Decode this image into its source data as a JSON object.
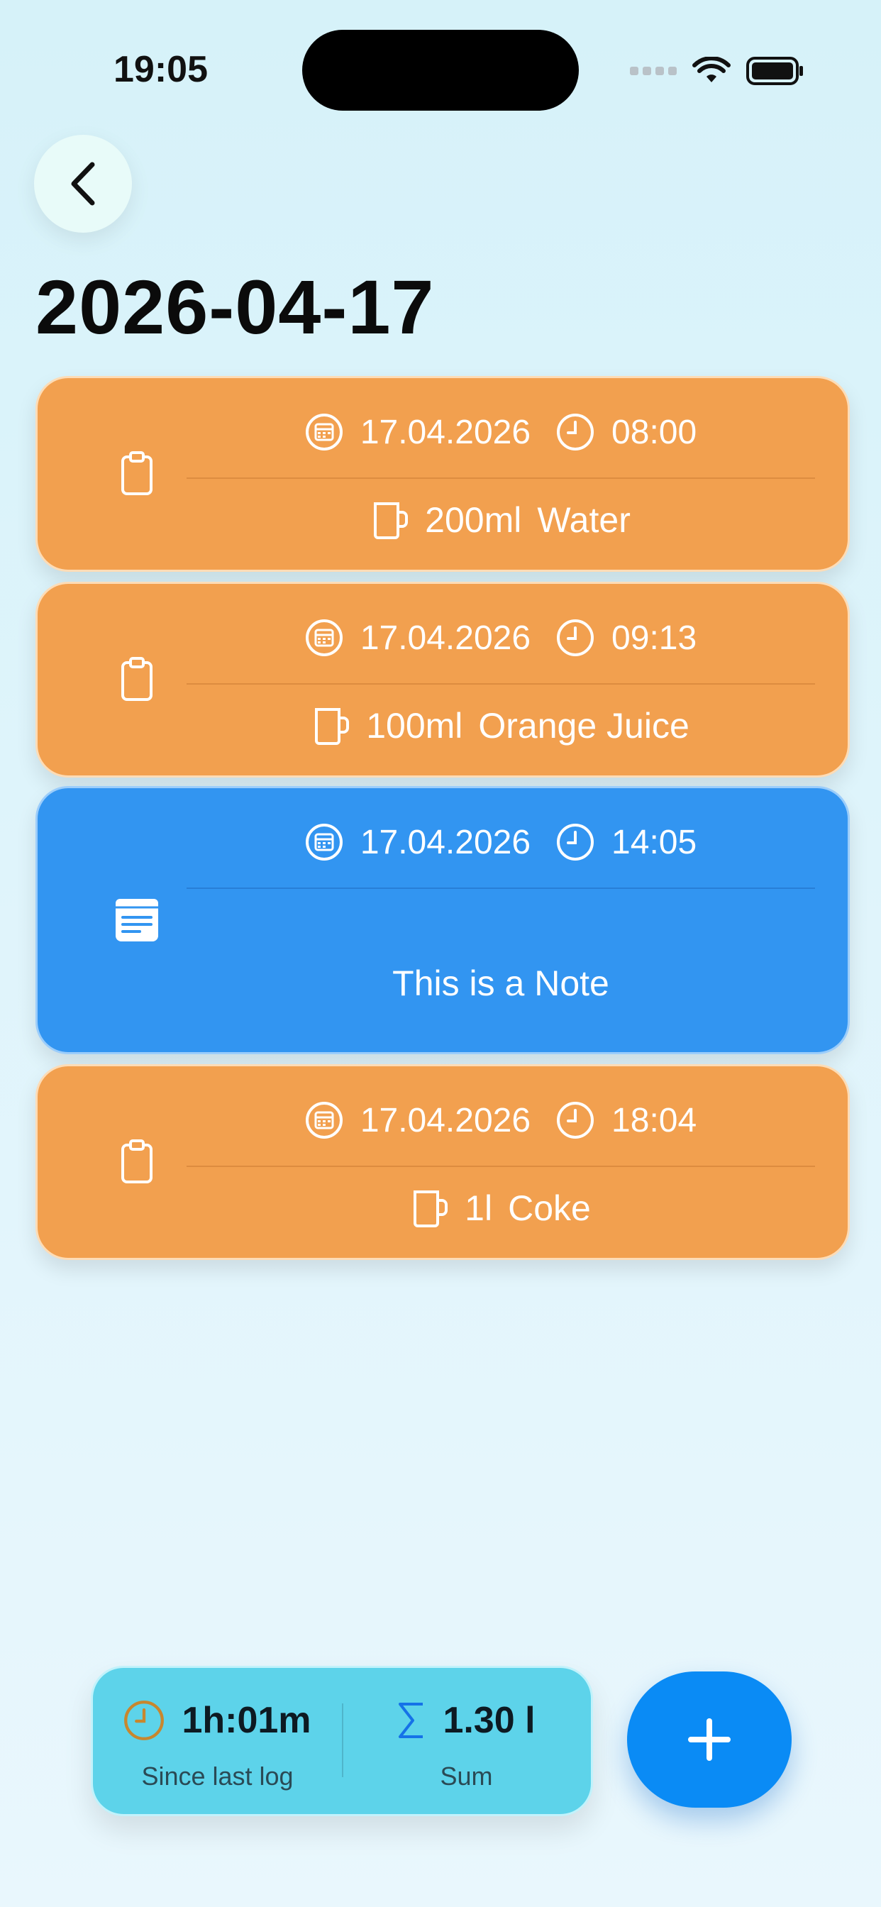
{
  "status_bar": {
    "time": "19:05"
  },
  "header": {
    "title": "2026-04-17"
  },
  "entries": [
    {
      "type": "log",
      "date": "17.04.2026",
      "time": "08:00",
      "amount": "200ml",
      "drink": "Water"
    },
    {
      "type": "log",
      "date": "17.04.2026",
      "time": "09:13",
      "amount": "100ml",
      "drink": "Orange Juice"
    },
    {
      "type": "note",
      "date": "17.04.2026",
      "time": "14:05",
      "text": "This is a Note"
    },
    {
      "type": "log",
      "date": "17.04.2026",
      "time": "18:04",
      "amount": "1l",
      "drink": "Coke"
    }
  ],
  "summary": {
    "since_value": "1h:01m",
    "since_label": "Since last log",
    "sum_value": "1.30 l",
    "sum_label": "Sum"
  },
  "colors": {
    "log_card": "#f2a04f",
    "note_card": "#3295f1",
    "summary_bg": "#5dd3ea",
    "fab": "#0a8bf5"
  },
  "icons": {
    "back": "chevron-left-icon",
    "log": "clipboard-icon",
    "note": "note-icon",
    "date": "calendar-icon",
    "time": "clock-icon",
    "drink": "mug-icon",
    "sum": "sigma-icon",
    "add": "plus-icon"
  }
}
